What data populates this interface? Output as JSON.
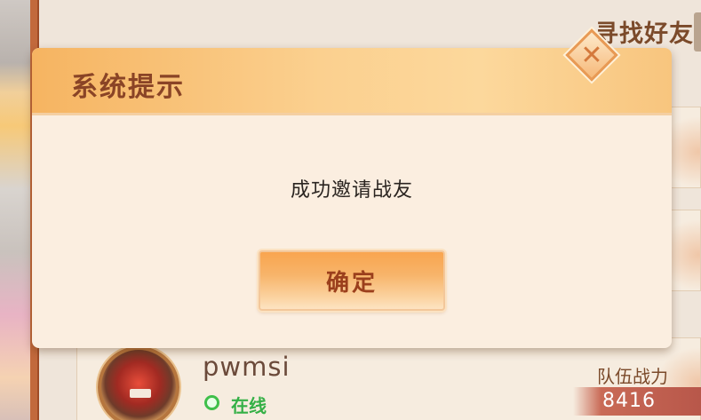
{
  "background": {
    "panel_title": "寻找好友",
    "player": {
      "name": "pwmsi",
      "status": "在线",
      "power_label": "队伍战力",
      "power_value": "8416"
    }
  },
  "dialog": {
    "title": "系统提示",
    "message": "成功邀请战友",
    "confirm_label": "确定",
    "close_icon": "close-icon"
  },
  "colors": {
    "header_orange": "#f6b461",
    "title_brown": "#8a4426",
    "online_green": "#34b046",
    "power_bar": "#b8574a"
  }
}
